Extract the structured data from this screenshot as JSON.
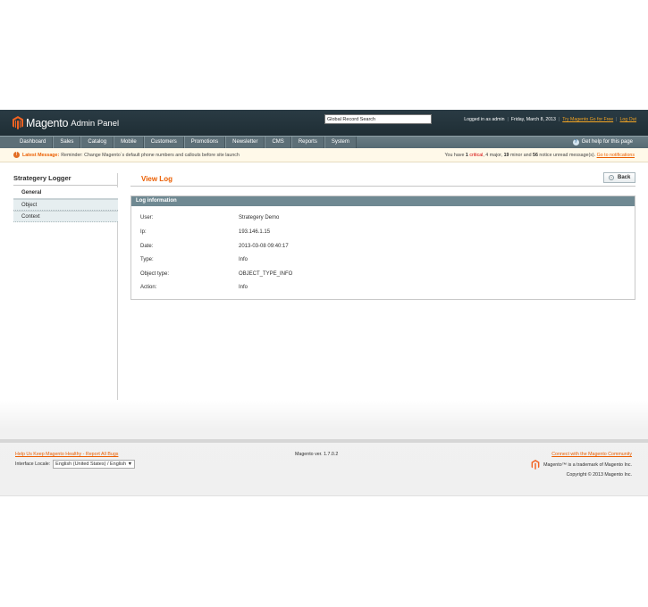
{
  "header": {
    "logo_word": "Magento",
    "logo_sub": "Admin Panel",
    "search_value": "Global Record Search",
    "logged_in": "Logged in as admin",
    "date": "Friday, March 8, 2013",
    "try_link": "Try Magento Go for Free",
    "logout": "Log Out"
  },
  "nav": {
    "items": [
      "Dashboard",
      "Sales",
      "Catalog",
      "Mobile",
      "Customers",
      "Promotions",
      "Newsletter",
      "CMS",
      "Reports",
      "System"
    ],
    "help": "Get help for this page"
  },
  "notice": {
    "label": "Latest Message:",
    "message": "Reminder: Change Magento`s default phone numbers and callouts before site launch",
    "prefix": "You have",
    "critical_count": "1",
    "critical_label": "critical",
    "major": ", 4 major, ",
    "minor_count": "19",
    "minor_label": " minor and ",
    "notice_count": "56",
    "notice_label": " notice unread message(s).",
    "link": "Go to notifications"
  },
  "sidebar": {
    "title": "Strategery Logger",
    "tabs": [
      "General",
      "Object",
      "Context"
    ]
  },
  "main": {
    "title": "View Log",
    "back": "Back",
    "box_title": "Log information",
    "fields": [
      {
        "label": "User:",
        "value": "Strategery Demo"
      },
      {
        "label": "Ip:",
        "value": "193.146.1.15"
      },
      {
        "label": "Date:",
        "value": "2013-03-08 09:40:17"
      },
      {
        "label": "Type:",
        "value": "Info"
      },
      {
        "label": "Object type:",
        "value": "OBJECT_TYPE_INFO"
      },
      {
        "label": "Action:",
        "value": "Info"
      }
    ]
  },
  "footer": {
    "bug_link": "Help Us Keep Magento Healthy - Report All Bugs",
    "locale_label": "Interface Locale:",
    "locale_value": "English (United States) / English",
    "version": "Magento ver. 1.7.0.2",
    "community_link": "Connect with the Magento Community",
    "trademark": "Magento™ is a trademark of Magento Inc.",
    "copyright": "Copyright © 2013 Magento Inc."
  },
  "colors": {
    "accent": "#eb5e00",
    "header_bg": "#2a3b44",
    "box_head": "#6f8992"
  }
}
